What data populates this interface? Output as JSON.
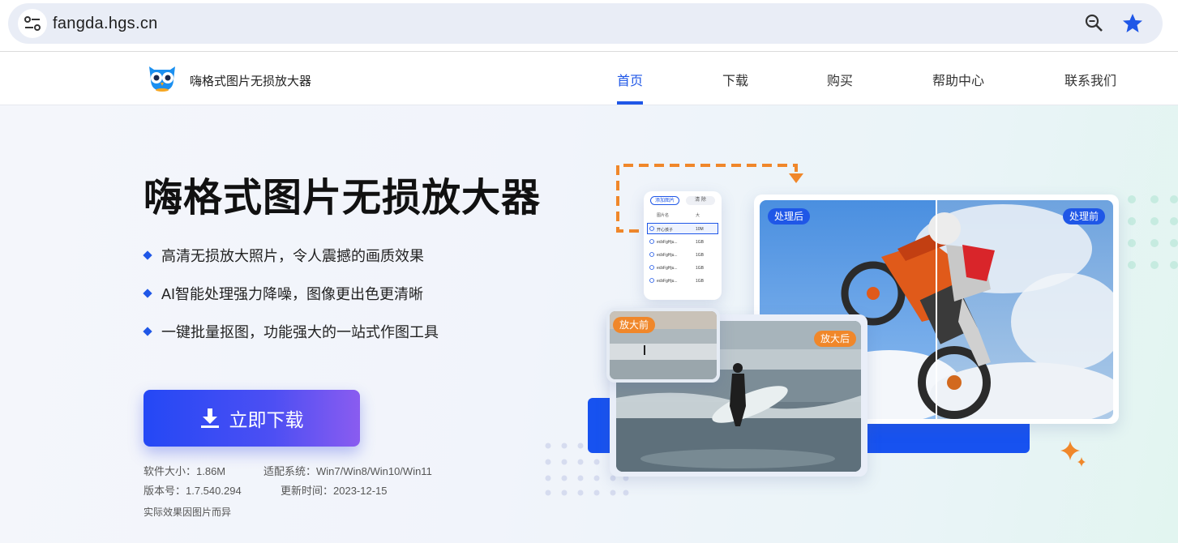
{
  "browser": {
    "url": "fangda.hgs.cn"
  },
  "header": {
    "site_name": "嗨格式图片无损放大器",
    "nav": [
      "首页",
      "下载",
      "购买",
      "帮助中心",
      "联系我们"
    ],
    "active_nav": "首页"
  },
  "hero": {
    "title": "嗨格式图片无损放大器",
    "features": [
      "高清无损放大照片，令人震撼的画质效果",
      "AI智能处理强力降噪，图像更出色更清晰",
      "一键批量抠图，功能强大的一站式作图工具"
    ],
    "download_label": "立即下载",
    "meta": {
      "size": "软件大小：1.86M",
      "system": "适配系统：Win7/Win8/Win10/Win11",
      "version": "版本号：1.7.540.294",
      "updated": "更新时间：2023-12-15"
    },
    "note": "实际效果因图片而异"
  },
  "illustration": {
    "tags": {
      "after_process": "处理后",
      "before_process": "处理前",
      "before_zoom": "放大前",
      "after_zoom": "放大后"
    },
    "mini_app": {
      "buttons": [
        "添加图片",
        "清 除"
      ],
      "header_cols": [
        "图片名",
        "大"
      ],
      "rows": [
        {
          "name": "开心孩子",
          "size": "10M"
        },
        {
          "name": "ecbFgHju...",
          "size": "1GB"
        },
        {
          "name": "ecbFgHju...",
          "size": "1GB"
        },
        {
          "name": "ecbFgHju...",
          "size": "1GB"
        },
        {
          "name": "ecbFgHju...",
          "size": "1GB"
        }
      ]
    }
  },
  "colors": {
    "accent": "#1f57e7",
    "orange": "#f0872a"
  }
}
